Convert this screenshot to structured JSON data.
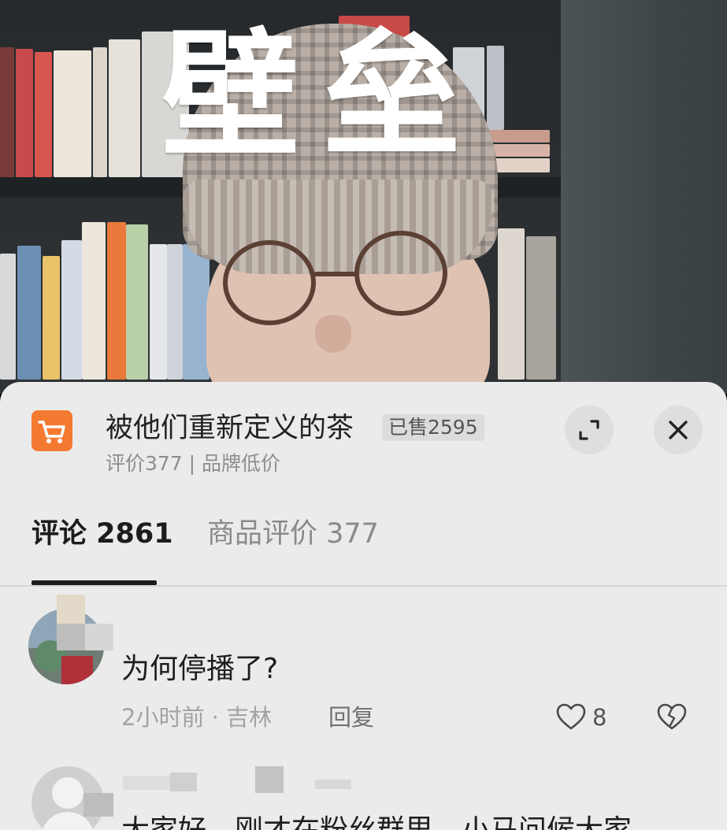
{
  "video": {
    "overlay_text": "壁垒"
  },
  "product": {
    "title": "被他们重新定义的茶",
    "sold_badge": "已售2595",
    "subtitle": "评价377 | 品牌低价",
    "icon": "cart-icon",
    "accent": "#f47a32"
  },
  "header_buttons": {
    "expand_icon": "expand-icon",
    "close_icon": "close-icon"
  },
  "tabs": [
    {
      "label": "评论 2861",
      "active": true
    },
    {
      "label": "商品评价 377",
      "active": false
    }
  ],
  "comments": [
    {
      "text": "为何停播了?",
      "time_location": "2小时前 · 吉林",
      "reply_label": "回复",
      "likes": "8"
    },
    {
      "text": "大家好，刚才在粉丝群里，小马问候大家"
    }
  ]
}
